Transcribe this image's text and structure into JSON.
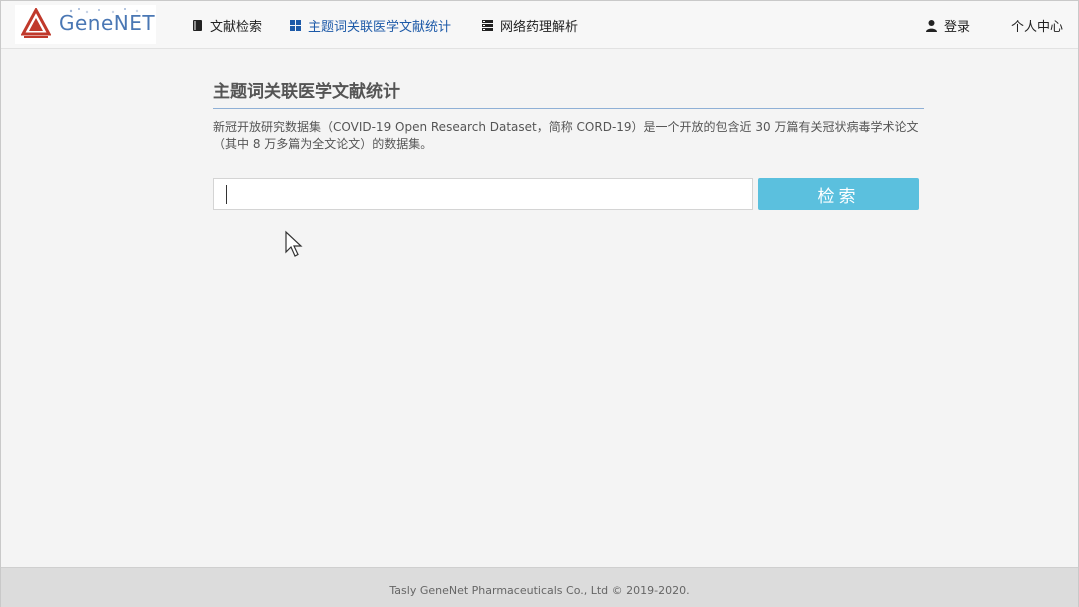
{
  "app": {
    "logo_text": "GeneNET",
    "logo_subtitle": "天士力控股集团"
  },
  "nav": {
    "items": [
      {
        "label": "文献检索",
        "icon": "book-icon"
      },
      {
        "label": "主题词关联医学文献统计",
        "icon": "grid-icon"
      },
      {
        "label": "网络药理解析",
        "icon": "list-icon"
      }
    ],
    "login_label": "登录",
    "user_center_label": "个人中心"
  },
  "main": {
    "title": "主题词关联医学文献统计",
    "description": "新冠开放研究数据集（COVID-19 Open Research Dataset，简称 CORD-19）是一个开放的包含近 30 万篇有关冠状病毒学术论文（其中 8 万多篇为全文论文）的数据集。",
    "search": {
      "value": "",
      "placeholder": "",
      "button_label": "检索"
    }
  },
  "footer": {
    "copyright": "Tasly GeneNet Pharmaceuticals Co., Ltd © 2019-2020."
  },
  "colors": {
    "accent": "#5bc0de",
    "nav_active": "#1d5aa8",
    "brand": "#4a77b4",
    "logo_red": "#c0392b"
  }
}
